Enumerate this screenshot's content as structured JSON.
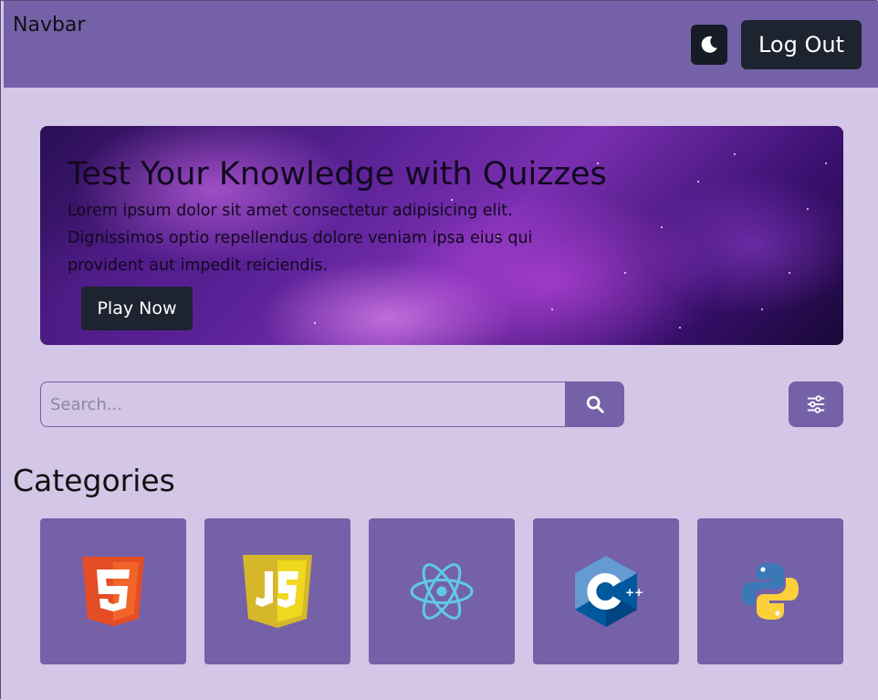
{
  "navbar": {
    "title": "Navbar",
    "theme_toggle_icon": "moon-icon",
    "logout_label": "Log Out"
  },
  "hero": {
    "title": "Test Your Knowledge with Quizzes",
    "text": "Lorem ipsum dolor sit amet consectetur adipisicing elit. Dignissimos optio repellendus dolore veniam ipsa eius qui provident aut impedit reiciendis.",
    "play_label": "Play Now",
    "background": "purple-nebula-space-image"
  },
  "search": {
    "placeholder": "Search...",
    "value": "",
    "search_icon": "search-icon",
    "filter_icon": "sliders-icon"
  },
  "categories": {
    "title": "Categories",
    "items": [
      {
        "name": "HTML5",
        "icon": "html5-icon"
      },
      {
        "name": "JavaScript",
        "icon": "javascript-icon"
      },
      {
        "name": "React",
        "icon": "react-icon"
      },
      {
        "name": "C++",
        "icon": "cplusplus-icon"
      },
      {
        "name": "Python",
        "icon": "python-icon"
      }
    ]
  },
  "colors": {
    "page_bg": "#d4c6e6",
    "primary": "#7461a8",
    "dark_button": "#1d2430"
  }
}
